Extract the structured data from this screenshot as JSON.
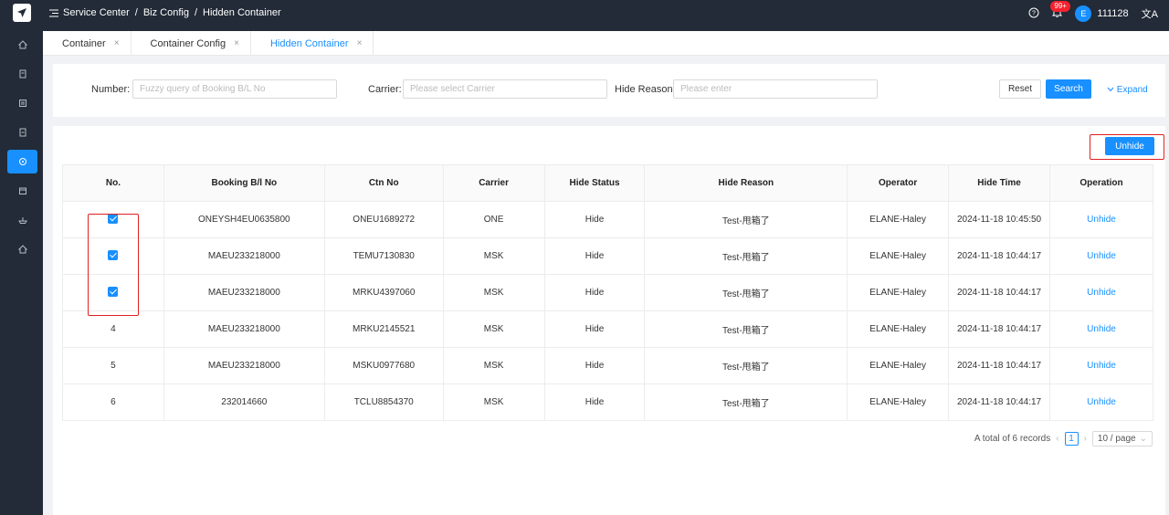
{
  "header": {
    "breadcrumb": [
      "Service Center",
      "/",
      "Biz Config",
      "/",
      "Hidden Container"
    ],
    "notification_badge": "99+",
    "avatar_letter": "E",
    "username": "111128"
  },
  "tabs": [
    {
      "label": "Container",
      "close": "×"
    },
    {
      "label": "Container Config",
      "close": "×"
    },
    {
      "label": "Hidden Container",
      "close": "×"
    }
  ],
  "filter": {
    "number_label": "Number:",
    "number_placeholder": "Fuzzy query of Booking B/L No",
    "carrier_label": "Carrier:",
    "carrier_placeholder": "Please select Carrier",
    "reason_label": "Hide Reason:",
    "reason_placeholder": "Please enter",
    "reset": "Reset",
    "search": "Search",
    "expand": "Expand"
  },
  "actions": {
    "unhide": "Unhide"
  },
  "table": {
    "columns": [
      "No.",
      "Booking B/l No",
      "Ctn No",
      "Carrier",
      "Hide Status",
      "Hide Reason",
      "Operator",
      "Hide Time",
      "Operation"
    ],
    "rows": [
      {
        "no": "",
        "checked": true,
        "booking": "ONEYSH4EU0635800",
        "ctn": "ONEU1689272",
        "carrier": "ONE",
        "status": "Hide",
        "reason": "Test-甩箱了",
        "operator": "ELANE-Haley",
        "time": "2024-11-18 10:45:50",
        "op": "Unhide"
      },
      {
        "no": "",
        "checked": true,
        "booking": "MAEU233218000",
        "ctn": "TEMU7130830",
        "carrier": "MSK",
        "status": "Hide",
        "reason": "Test-甩箱了",
        "operator": "ELANE-Haley",
        "time": "2024-11-18 10:44:17",
        "op": "Unhide"
      },
      {
        "no": "",
        "checked": true,
        "booking": "MAEU233218000",
        "ctn": "MRKU4397060",
        "carrier": "MSK",
        "status": "Hide",
        "reason": "Test-甩箱了",
        "operator": "ELANE-Haley",
        "time": "2024-11-18 10:44:17",
        "op": "Unhide"
      },
      {
        "no": "4",
        "checked": false,
        "booking": "MAEU233218000",
        "ctn": "MRKU2145521",
        "carrier": "MSK",
        "status": "Hide",
        "reason": "Test-甩箱了",
        "operator": "ELANE-Haley",
        "time": "2024-11-18 10:44:17",
        "op": "Unhide"
      },
      {
        "no": "5",
        "checked": false,
        "booking": "MAEU233218000",
        "ctn": "MSKU0977680",
        "carrier": "MSK",
        "status": "Hide",
        "reason": "Test-甩箱了",
        "operator": "ELANE-Haley",
        "time": "2024-11-18 10:44:17",
        "op": "Unhide"
      },
      {
        "no": "6",
        "checked": false,
        "booking": "232014660",
        "ctn": "TCLU8854370",
        "carrier": "MSK",
        "status": "Hide",
        "reason": "Test-甩箱了",
        "operator": "ELANE-Haley",
        "time": "2024-11-18 10:44:17",
        "op": "Unhide"
      }
    ]
  },
  "pagination": {
    "total": "A total of 6 records",
    "current": "1",
    "page_size": "10 / page"
  },
  "colors": {
    "primary": "#1890ff",
    "sidebar": "#222b37",
    "highlight": "#e02020"
  }
}
